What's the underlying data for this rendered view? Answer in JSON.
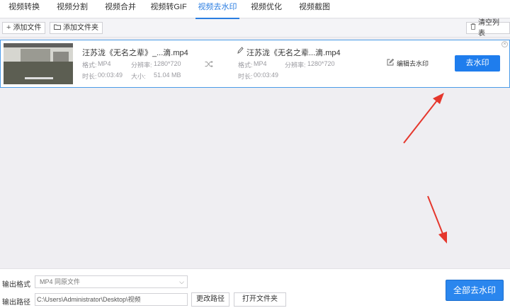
{
  "tabs": [
    {
      "label": "视频转换",
      "active": false
    },
    {
      "label": "视频分割",
      "active": false
    },
    {
      "label": "视频合并",
      "active": false
    },
    {
      "label": "视频转GIF",
      "active": false
    },
    {
      "label": "视频去水印",
      "active": true
    },
    {
      "label": "视频优化",
      "active": false
    },
    {
      "label": "视频截图",
      "active": false
    }
  ],
  "toolbar": {
    "add_file": "添加文件",
    "add_folder": "添加文件夹",
    "clear_list": "清空列表"
  },
  "file": {
    "source_name": "汪苏泷《无名之辈》_...滴.mp4",
    "source_format_label": "格式:",
    "source_format": "MP4",
    "source_resolution_label": "分辨率:",
    "source_resolution": "1280*720",
    "source_duration_label": "时长:",
    "source_duration": "00:03:49",
    "source_size_label": "大小:",
    "source_size": "51.04 MB",
    "output_name": "汪苏泷《无名之辈...滴.mp4",
    "output_format_label": "格式:",
    "output_format": "MP4",
    "output_resolution_label": "分辨率:",
    "output_resolution": "1280*720",
    "output_duration_label": "时长:",
    "output_duration": "00:03:49",
    "edit_label": "编辑去水印",
    "remove_label": "去水印"
  },
  "bottom": {
    "format_label": "输出格式",
    "format_value": "MP4  同原文件",
    "path_label": "输出路径",
    "path_value": "C:\\Users\\Administrator\\Desktop\\视频",
    "change_path": "更改路径",
    "open_folder": "打开文件夹",
    "remove_all": "全部去水印"
  },
  "colors": {
    "accent": "#2a7de1",
    "button_blue": "#1f7ded",
    "arrow_red": "#e5372d"
  }
}
